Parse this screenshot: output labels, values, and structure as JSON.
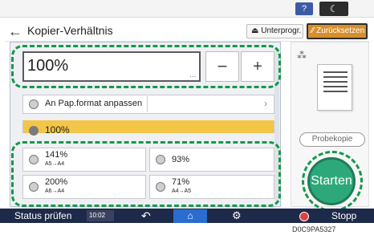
{
  "topbar": {
    "help_label": "?",
    "moon_label": "☾"
  },
  "header": {
    "back_label": "←",
    "title": "Kopier-Verhältnis",
    "unterprog_label": "Unterprogr.",
    "zurueck_label": "Zurücksetzen"
  },
  "zoom": {
    "value": "100%",
    "dots": "...",
    "minus_label": "−",
    "plus_label": "+"
  },
  "options": {
    "fit_paper_label": "An Pap.format anpassen",
    "selected_label": "100%"
  },
  "presets": [
    {
      "main": "141%",
      "sub": "A5→A4"
    },
    {
      "main": "93%",
      "sub": ""
    },
    {
      "main": "200%",
      "sub": "A6→A4"
    },
    {
      "main": "71%",
      "sub": "A4→A5"
    }
  ],
  "right": {
    "probekopie_label": "Probekopie",
    "starten_label": "Starten"
  },
  "bottom": {
    "status_label": "Status prüfen",
    "time": "10:02",
    "stopp_label": "Stopp"
  },
  "watermark": "D0C9PA5327",
  "colors": {
    "highlight": "#159947",
    "start": "#2da87a",
    "selected": "#f3c64a",
    "accent": "#d68f2c"
  }
}
